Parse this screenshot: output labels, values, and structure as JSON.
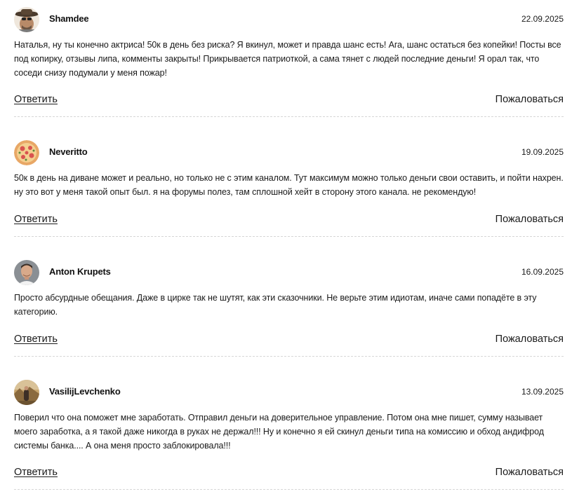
{
  "comments": [
    {
      "author": "Shamdee",
      "date": "22.09.2025",
      "avatar_icon": "man-with-hat-avatar",
      "text": "Наталья, ну ты конечно актриса! 50к в день без риска? Я вкинул, может и правда шанс есть! Ага, шанс остаться без копейки! Посты все под копирку, отзывы липа, комменты закрыты! Прикрывается патриоткой, а сама тянет с людей последние деньги! Я орал так, что соседи снизу подумали у меня пожар!",
      "reply_label": "Ответить",
      "report_label": "Пожаловаться"
    },
    {
      "author": "Neveritto",
      "date": "19.09.2025",
      "avatar_icon": "pizza-avatar",
      "text": "50к в день на диване может и реально, но только не с этим каналом. Тут максимум можно только деньги свои оставить, и пойти нахрен. ну это вот у меня такой опыт был. я на форумы полез, там сплошной хейт в сторону этого канала. не рекомендую!",
      "reply_label": "Ответить",
      "report_label": "Пожаловаться"
    },
    {
      "author": "Anton Krupets",
      "date": "16.09.2025",
      "avatar_icon": "man-portrait-avatar",
      "text": "Просто абсурдные обещания. Даже в цирке так не шутят, как эти сказочники. Не верьте этим идиотам, иначе сами попадёте в эту категорию.",
      "reply_label": "Ответить",
      "report_label": "Пожаловаться"
    },
    {
      "author": "VasilijLevchenko",
      "date": "13.09.2025",
      "avatar_icon": "outdoor-photo-avatar",
      "text": "Поверил что она поможет мне заработать. Отправил деньги на доверительное управление. Потом она мне пишет, сумму называет моего заработка, а я такой даже никогда в руках не держал!!! Ну и конечно я ей скинул деньги типа на комиссию и обход андифрод системы банка.... А она меня просто заблокировала!!!",
      "reply_label": "Ответить",
      "report_label": "Пожаловаться"
    }
  ]
}
